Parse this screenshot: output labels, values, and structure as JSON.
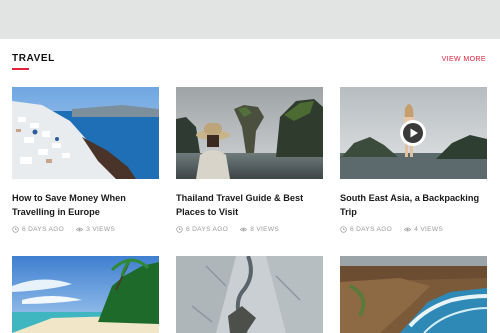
{
  "section": {
    "title": "TRAVEL",
    "view_more": "VIEW MORE"
  },
  "colors": {
    "accent": "#e0223a",
    "top_band": "#e2e4e3",
    "meta_text": "#9a9a9a"
  },
  "cards": [
    {
      "title": "How to Save Money When Travelling in Europe",
      "date": "6 DAYS AGO",
      "views": "3 VIEWS",
      "has_video": false
    },
    {
      "title": "Thailand Travel Guide & Best Places to Visit",
      "date": "6 DAYS AGO",
      "views": "8 VIEWS",
      "has_video": false
    },
    {
      "title": "South East Asia, a Backpacking Trip",
      "date": "6 DAYS AGO",
      "views": "4 VIEWS",
      "has_video": true
    }
  ],
  "icons": {
    "date": "clock-icon",
    "views": "eye-icon",
    "video": "play-icon"
  }
}
